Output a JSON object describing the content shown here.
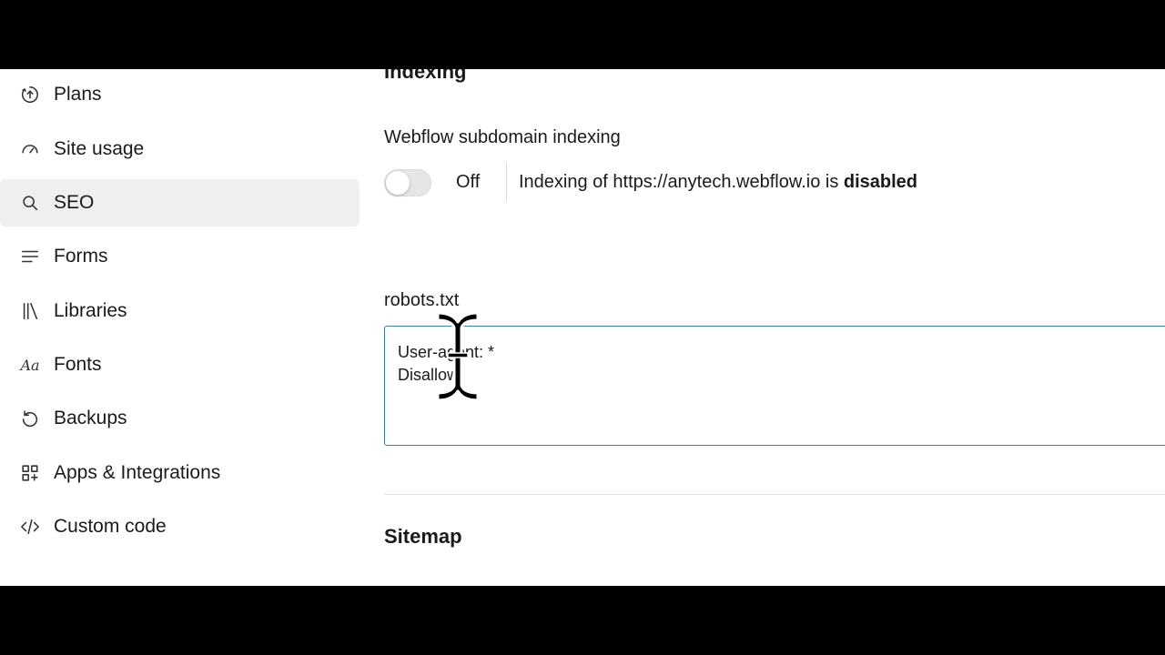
{
  "sidebar": {
    "items": [
      {
        "label": "Plans",
        "icon": "upgrade-circle-icon",
        "active": false
      },
      {
        "label": "Site usage",
        "icon": "gauge-icon",
        "active": false
      },
      {
        "label": "SEO",
        "icon": "search-icon",
        "active": true
      },
      {
        "label": "Forms",
        "icon": "lines-icon",
        "active": false
      },
      {
        "label": "Libraries",
        "icon": "library-icon",
        "active": false
      },
      {
        "label": "Fonts",
        "icon": "fonts-icon",
        "active": false
      },
      {
        "label": "Backups",
        "icon": "restore-icon",
        "active": false
      },
      {
        "label": "Apps & Integrations",
        "icon": "apps-icon",
        "active": false
      },
      {
        "label": "Custom code",
        "icon": "code-icon",
        "active": false
      }
    ],
    "fonts_icon_text": "Aa"
  },
  "main": {
    "indexing": {
      "title": "Indexing",
      "subdomain_label": "Webflow subdomain indexing",
      "toggle_state": "Off",
      "message_prefix": "Indexing of https://anytech.webflow.io is ",
      "message_status": "disabled"
    },
    "robots": {
      "label": "robots.txt",
      "value": "User-agent: *\nDisallow:"
    },
    "sitemap": {
      "title": "Sitemap"
    }
  },
  "colors": {
    "active_nav_bg": "#efefef",
    "textarea_border": "#3d7ea6",
    "toggle_off_bg": "#e6e6e6"
  }
}
